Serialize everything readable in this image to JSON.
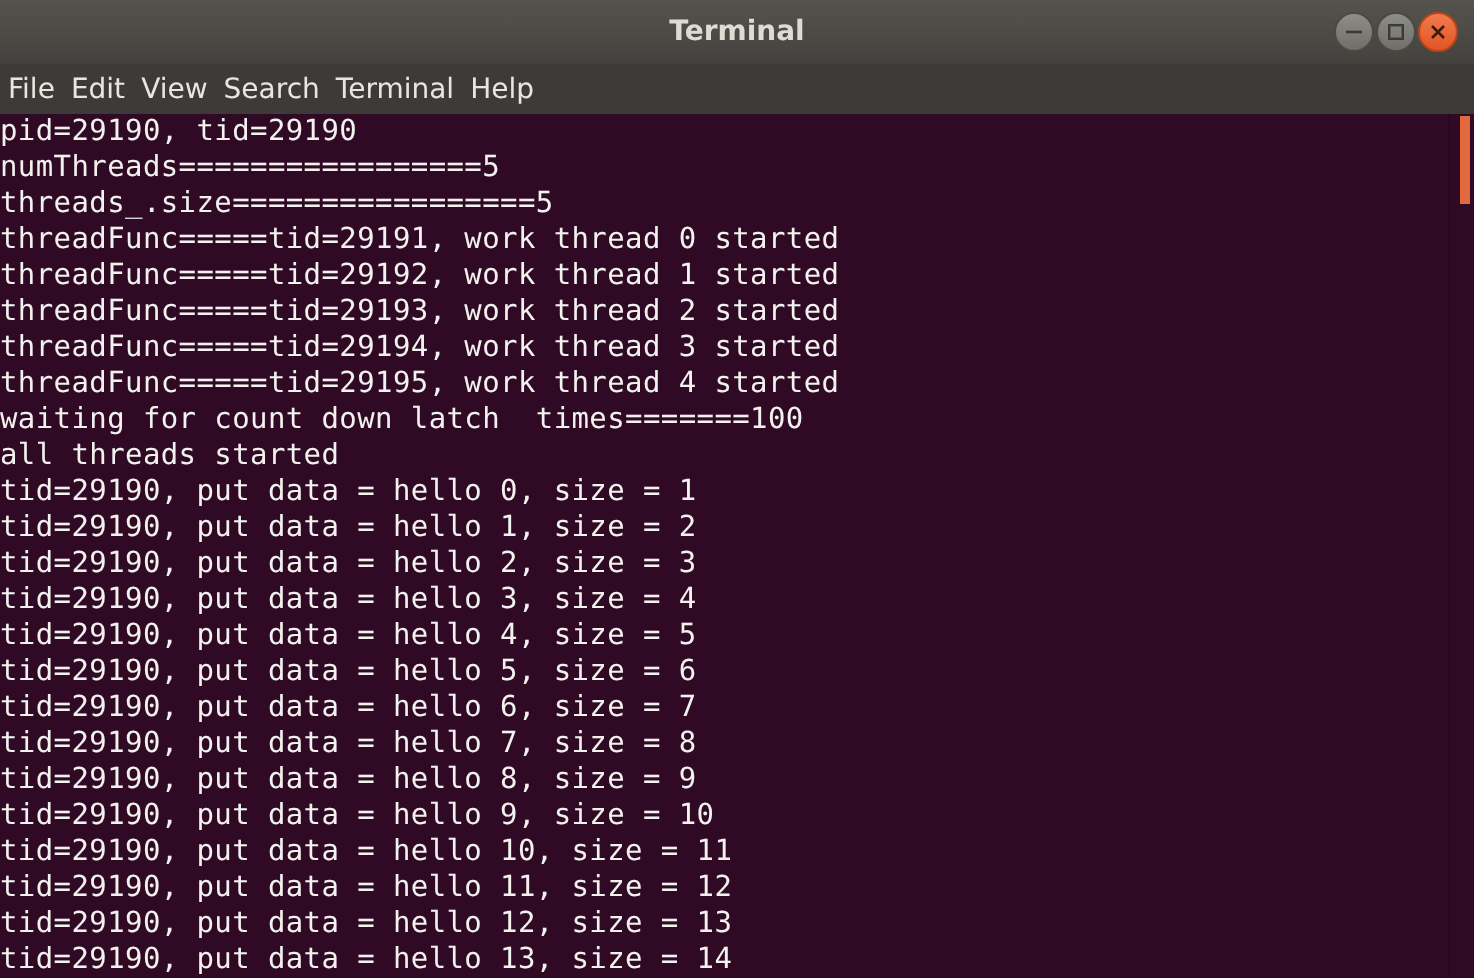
{
  "window": {
    "title": "Terminal"
  },
  "menu": [
    "File",
    "Edit",
    "View",
    "Search",
    "Terminal",
    "Help"
  ],
  "lines": [
    "pid=29190, tid=29190",
    "numThreads=================5",
    "threads_.size=================5",
    "threadFunc=====tid=29191, work thread 0 started",
    "threadFunc=====tid=29192, work thread 1 started",
    "threadFunc=====tid=29193, work thread 2 started",
    "threadFunc=====tid=29194, work thread 3 started",
    "threadFunc=====tid=29195, work thread 4 started",
    "waiting for count down latch  times=======100",
    "all threads started",
    "tid=29190, put data = hello 0, size = 1",
    "tid=29190, put data = hello 1, size = 2",
    "tid=29190, put data = hello 2, size = 3",
    "tid=29190, put data = hello 3, size = 4",
    "tid=29190, put data = hello 4, size = 5",
    "tid=29190, put data = hello 5, size = 6",
    "tid=29190, put data = hello 6, size = 7",
    "tid=29190, put data = hello 7, size = 8",
    "tid=29190, put data = hello 8, size = 9",
    "tid=29190, put data = hello 9, size = 10",
    "tid=29190, put data = hello 10, size = 11",
    "tid=29190, put data = hello 11, size = 12",
    "tid=29190, put data = hello 12, size = 13",
    "tid=29190, put data = hello 13, size = 14"
  ]
}
